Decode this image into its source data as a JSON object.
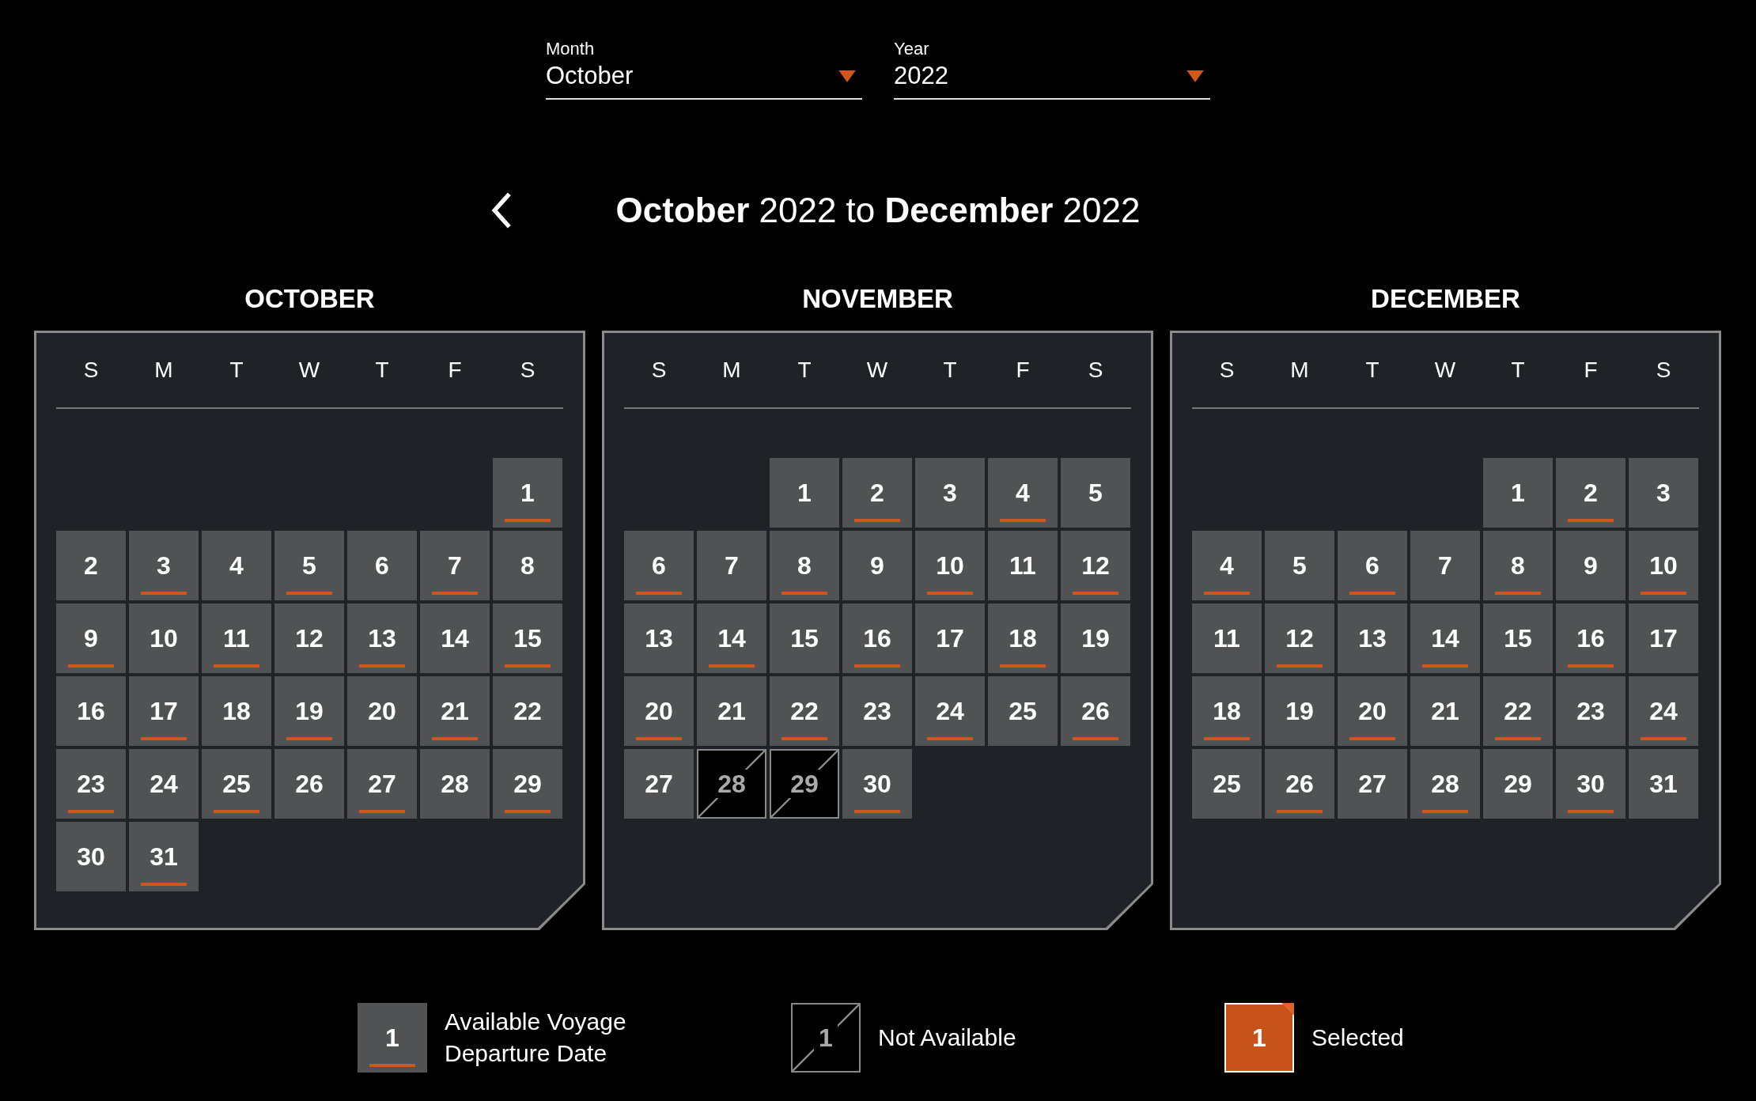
{
  "month_select": {
    "label": "Month",
    "value": "October"
  },
  "year_select": {
    "label": "Year",
    "value": "2022"
  },
  "range_title": "**October** 2022 to **December** 2022",
  "months": [
    {
      "name": "OCTOBER",
      "weekdays": [
        "S",
        "M",
        "T",
        "W",
        "T",
        "F",
        "S"
      ],
      "days": [
        {
          "kind": "empty"
        },
        {
          "kind": "empty"
        },
        {
          "kind": "empty"
        },
        {
          "kind": "empty"
        },
        {
          "kind": "empty"
        },
        {
          "kind": "empty"
        },
        {
          "day": "1",
          "kind": "available",
          "underlined": true
        },
        {
          "day": "2",
          "kind": "available",
          "underlined": false
        },
        {
          "day": "3",
          "kind": "available",
          "underlined": true
        },
        {
          "day": "4",
          "kind": "available",
          "underlined": false
        },
        {
          "day": "5",
          "kind": "available",
          "underlined": true
        },
        {
          "day": "6",
          "kind": "available",
          "underlined": false
        },
        {
          "day": "7",
          "kind": "available",
          "underlined": true
        },
        {
          "day": "8",
          "kind": "available",
          "underlined": false
        },
        {
          "day": "9",
          "kind": "available",
          "underlined": true
        },
        {
          "day": "10",
          "kind": "available",
          "underlined": false
        },
        {
          "day": "11",
          "kind": "available",
          "underlined": true
        },
        {
          "day": "12",
          "kind": "available",
          "underlined": false
        },
        {
          "day": "13",
          "kind": "available",
          "underlined": true
        },
        {
          "day": "14",
          "kind": "available",
          "underlined": false
        },
        {
          "day": "15",
          "kind": "available",
          "underlined": true
        },
        {
          "day": "16",
          "kind": "available",
          "underlined": false
        },
        {
          "day": "17",
          "kind": "available",
          "underlined": true
        },
        {
          "day": "18",
          "kind": "available",
          "underlined": false
        },
        {
          "day": "19",
          "kind": "available",
          "underlined": true
        },
        {
          "day": "20",
          "kind": "available",
          "underlined": false
        },
        {
          "day": "21",
          "kind": "available",
          "underlined": true
        },
        {
          "day": "22",
          "kind": "available",
          "underlined": false
        },
        {
          "day": "23",
          "kind": "available",
          "underlined": true
        },
        {
          "day": "24",
          "kind": "available",
          "underlined": false
        },
        {
          "day": "25",
          "kind": "available",
          "underlined": true
        },
        {
          "day": "26",
          "kind": "available",
          "underlined": false
        },
        {
          "day": "27",
          "kind": "available",
          "underlined": true
        },
        {
          "day": "28",
          "kind": "available",
          "underlined": false
        },
        {
          "day": "29",
          "kind": "available",
          "underlined": true
        },
        {
          "day": "30",
          "kind": "available",
          "underlined": false
        },
        {
          "day": "31",
          "kind": "available",
          "underlined": true
        }
      ]
    },
    {
      "name": "NOVEMBER",
      "weekdays": [
        "S",
        "M",
        "T",
        "W",
        "T",
        "F",
        "S"
      ],
      "days": [
        {
          "kind": "empty"
        },
        {
          "kind": "empty"
        },
        {
          "day": "1",
          "kind": "available",
          "underlined": false
        },
        {
          "day": "2",
          "kind": "available",
          "underlined": true
        },
        {
          "day": "3",
          "kind": "available",
          "underlined": false
        },
        {
          "day": "4",
          "kind": "available",
          "underlined": true
        },
        {
          "day": "5",
          "kind": "available",
          "underlined": false
        },
        {
          "day": "6",
          "kind": "available",
          "underlined": true
        },
        {
          "day": "7",
          "kind": "available",
          "underlined": false
        },
        {
          "day": "8",
          "kind": "available",
          "underlined": true
        },
        {
          "day": "9",
          "kind": "available",
          "underlined": false
        },
        {
          "day": "10",
          "kind": "available",
          "underlined": true
        },
        {
          "day": "11",
          "kind": "available",
          "underlined": false
        },
        {
          "day": "12",
          "kind": "available",
          "underlined": true
        },
        {
          "day": "13",
          "kind": "available",
          "underlined": false
        },
        {
          "day": "14",
          "kind": "available",
          "underlined": true
        },
        {
          "day": "15",
          "kind": "available",
          "underlined": false
        },
        {
          "day": "16",
          "kind": "available",
          "underlined": true
        },
        {
          "day": "17",
          "kind": "available",
          "underlined": false
        },
        {
          "day": "18",
          "kind": "available",
          "underlined": true
        },
        {
          "day": "19",
          "kind": "available",
          "underlined": false
        },
        {
          "day": "20",
          "kind": "available",
          "underlined": true
        },
        {
          "day": "21",
          "kind": "available",
          "underlined": false
        },
        {
          "day": "22",
          "kind": "available",
          "underlined": true
        },
        {
          "day": "23",
          "kind": "available",
          "underlined": false
        },
        {
          "day": "24",
          "kind": "available",
          "underlined": true
        },
        {
          "day": "25",
          "kind": "available",
          "underlined": false
        },
        {
          "day": "26",
          "kind": "available",
          "underlined": true
        },
        {
          "day": "27",
          "kind": "available",
          "underlined": false
        },
        {
          "day": "28",
          "kind": "unavailable",
          "underlined": false
        },
        {
          "day": "29",
          "kind": "unavailable",
          "underlined": false
        },
        {
          "day": "30",
          "kind": "available",
          "underlined": true
        }
      ]
    },
    {
      "name": "DECEMBER",
      "weekdays": [
        "S",
        "M",
        "T",
        "W",
        "T",
        "F",
        "S"
      ],
      "days": [
        {
          "kind": "empty"
        },
        {
          "kind": "empty"
        },
        {
          "kind": "empty"
        },
        {
          "kind": "empty"
        },
        {
          "day": "1",
          "kind": "available",
          "underlined": false
        },
        {
          "day": "2",
          "kind": "available",
          "underlined": true
        },
        {
          "day": "3",
          "kind": "available",
          "underlined": false
        },
        {
          "day": "4",
          "kind": "available",
          "underlined": true
        },
        {
          "day": "5",
          "kind": "available",
          "underlined": false
        },
        {
          "day": "6",
          "kind": "available",
          "underlined": true
        },
        {
          "day": "7",
          "kind": "available",
          "underlined": false
        },
        {
          "day": "8",
          "kind": "available",
          "underlined": true
        },
        {
          "day": "9",
          "kind": "available",
          "underlined": false
        },
        {
          "day": "10",
          "kind": "available",
          "underlined": true
        },
        {
          "day": "11",
          "kind": "available",
          "underlined": false
        },
        {
          "day": "12",
          "kind": "available",
          "underlined": true
        },
        {
          "day": "13",
          "kind": "available",
          "underlined": false
        },
        {
          "day": "14",
          "kind": "available",
          "underlined": true
        },
        {
          "day": "15",
          "kind": "available",
          "underlined": false
        },
        {
          "day": "16",
          "kind": "available",
          "underlined": true
        },
        {
          "day": "17",
          "kind": "available",
          "underlined": false
        },
        {
          "day": "18",
          "kind": "available",
          "underlined": true
        },
        {
          "day": "19",
          "kind": "available",
          "underlined": false
        },
        {
          "day": "20",
          "kind": "available",
          "underlined": true
        },
        {
          "day": "21",
          "kind": "available",
          "underlined": false
        },
        {
          "day": "22",
          "kind": "available",
          "underlined": true
        },
        {
          "day": "23",
          "kind": "available",
          "underlined": false
        },
        {
          "day": "24",
          "kind": "available",
          "underlined": true
        },
        {
          "day": "25",
          "kind": "available",
          "underlined": false
        },
        {
          "day": "26",
          "kind": "available",
          "underlined": true
        },
        {
          "day": "27",
          "kind": "available",
          "underlined": false
        },
        {
          "day": "28",
          "kind": "available",
          "underlined": true
        },
        {
          "day": "29",
          "kind": "available",
          "underlined": false
        },
        {
          "day": "30",
          "kind": "available",
          "underlined": true
        },
        {
          "day": "31",
          "kind": "available",
          "underlined": false
        }
      ]
    }
  ],
  "legend": [
    {
      "kind": "available",
      "sample": "1",
      "label": "Available Voyage Departure Date"
    },
    {
      "kind": "unavailable",
      "sample": "1",
      "label": "Not Available"
    },
    {
      "kind": "selected",
      "sample": "1",
      "label": "Selected"
    }
  ]
}
